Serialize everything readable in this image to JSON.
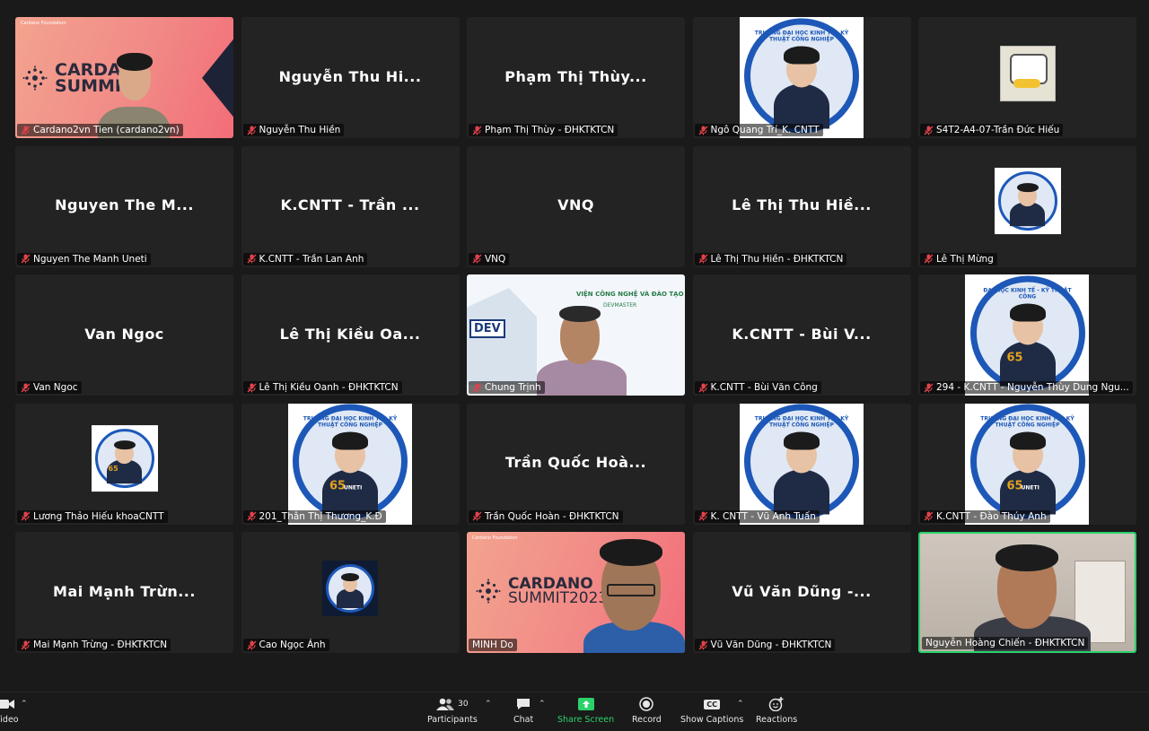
{
  "tiles": [
    {
      "kind": "cardano",
      "label": "Cardano2vn Tien (cardano2vn)",
      "muted": true,
      "title1": "CARDANO",
      "title2": "SUMMIT",
      "brand": "Cardano Foundation"
    },
    {
      "kind": "name",
      "display": "Nguyễn Thu Hi...",
      "label": "Nguyễn Thu Hiền",
      "muted": true
    },
    {
      "kind": "name",
      "display": "Phạm Thị Thùy...",
      "label": "Phạm Thị Thùy - ĐHKTKTCN",
      "muted": true
    },
    {
      "kind": "badge",
      "label": "Ngô Quang Trí_K. CNTT",
      "muted": true,
      "ring_text": "TRƯỜNG ĐẠI HỌC KINH TẾ - KỸ THUẬT CÔNG NGHIỆP"
    },
    {
      "kind": "thumb",
      "label": "S4T2-A4-07-Trần Đức Hiếu",
      "muted": true
    },
    {
      "kind": "name",
      "display": "Nguyen The M...",
      "label": "Nguyen The Manh Uneti",
      "muted": true
    },
    {
      "kind": "name",
      "display": "K.CNTT - Trần ...",
      "label": "K.CNTT - Trần Lan Anh",
      "muted": true
    },
    {
      "kind": "name",
      "display": "VNQ",
      "label": "VNQ",
      "muted": true
    },
    {
      "kind": "name",
      "display": "Lê Thị Thu Hiề...",
      "label": "Lê Thị Thu Hiền - ĐHKTKTCN",
      "muted": true
    },
    {
      "kind": "smallbadge",
      "label": "Lê Thị Mừng",
      "muted": true
    },
    {
      "kind": "name",
      "display": "Van Ngoc",
      "label": "Van Ngoc",
      "muted": true
    },
    {
      "kind": "name",
      "display": "Lê Thị Kiều Oa...",
      "label": "Lê Thị Kiều Oanh - ĐHKTKTCN",
      "muted": true
    },
    {
      "kind": "video-dev",
      "label": "Chung Trịnh",
      "muted": true,
      "screen_text": "VIỆN CÔNG NGHỆ VÀ ĐÀO TẠO",
      "screen_sub": "DEVMASTER",
      "logo": "DEV"
    },
    {
      "kind": "name",
      "display": "K.CNTT - Bùi V...",
      "label": "K.CNTT - Bùi Văn Công",
      "muted": true
    },
    {
      "kind": "badge",
      "label": "294 - K.CNTT - Nguyễn Thùy Dung Ngu...",
      "muted": true,
      "ring_text": "ĐẠI HỌC KINH TẾ - KỸ THUẬT CÔNG",
      "num": "65"
    },
    {
      "kind": "smallbadge",
      "label": "Lương Thảo Hiếu khoaCNTT",
      "muted": true,
      "num": "65"
    },
    {
      "kind": "badge",
      "label": "201_Thân Thị Thương_K.Đ",
      "muted": true,
      "ring_text": "TRƯỜNG ĐẠI HỌC KINH TẾ - KỸ THUẬT CÔNG NGHIỆP",
      "num": "65",
      "uneti": "UNETI"
    },
    {
      "kind": "name",
      "display": "Trần Quốc Hoà...",
      "label": "Trần Quốc Hoàn - ĐHKTKTCN",
      "muted": true
    },
    {
      "kind": "badge",
      "label": "K. CNTT - Vũ Anh Tuấn",
      "muted": true,
      "ring_text": "TRƯỜNG ĐẠI HỌC KINH TẾ - KỸ THUẬT CÔNG NGHIỆP"
    },
    {
      "kind": "badge",
      "label": "K.CNTT - Đào Thúy Anh",
      "muted": true,
      "ring_text": "TRƯỜNG ĐẠI HỌC KINH TẾ - KỸ THUẬT CÔNG NGHIỆP",
      "num": "65",
      "uneti": "UNETI"
    },
    {
      "kind": "name",
      "display": "Mai Mạnh Trừn...",
      "label": "Mai Mạnh Trừng - ĐHKTKTCN",
      "muted": true
    },
    {
      "kind": "smallbadge",
      "label": "Cao Ngọc Ánh",
      "muted": true
    },
    {
      "kind": "cardano2",
      "label": "MINH Do",
      "muted": false,
      "title1": "CARDANO",
      "title2": "SUMMIT2023",
      "brand": "Cardano Foundation"
    },
    {
      "kind": "name",
      "display": "Vũ Văn Dũng -...",
      "label": "Vũ Văn Dũng - ĐHKTKTCN",
      "muted": true
    },
    {
      "kind": "video-home",
      "label": "Nguyễn Hoàng Chiến - ĐHKTKTCN",
      "muted": false,
      "active": true
    }
  ],
  "toolbar": {
    "video": "Video",
    "participants": "Participants",
    "participants_count": "30",
    "chat": "Chat",
    "share": "Share Screen",
    "record": "Record",
    "captions": "Show Captions",
    "captions_icon": "CC",
    "reactions": "Reactions"
  },
  "colors": {
    "bg": "#1a1a1a",
    "tile": "#232323",
    "active_border": "#2bd26b",
    "share_green": "#2bd26b",
    "mute_red": "#e0424a",
    "uneti_blue": "#1d58b8"
  }
}
